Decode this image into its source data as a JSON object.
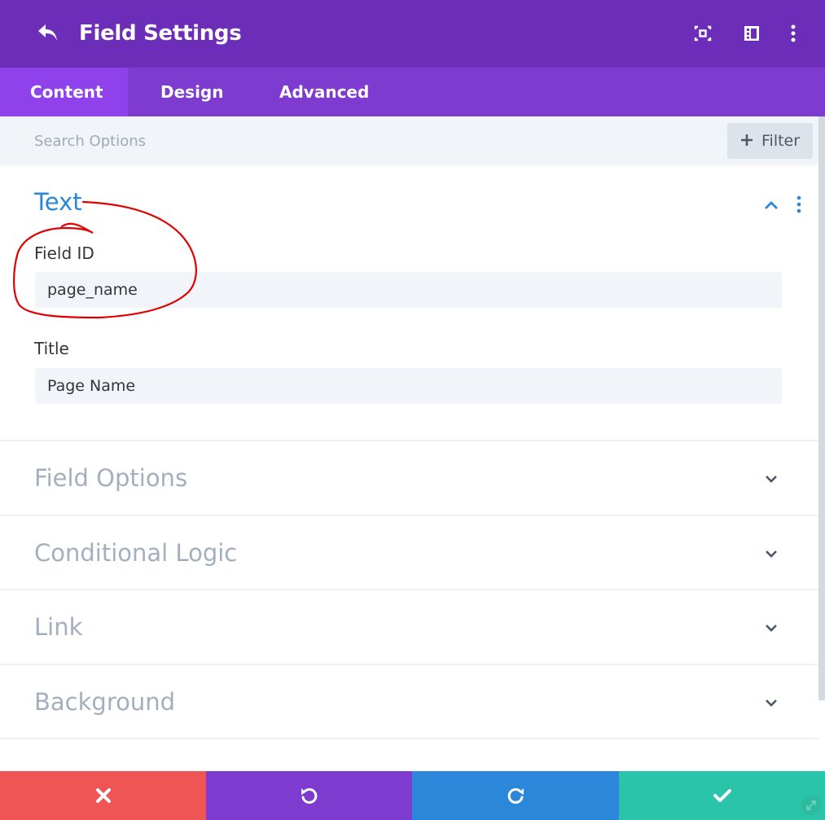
{
  "header": {
    "title": "Field Settings",
    "icons": [
      "back-icon",
      "focus-icon",
      "sidebar-layout-icon",
      "more-vertical-icon"
    ]
  },
  "tabs": [
    {
      "label": "Content",
      "active": true
    },
    {
      "label": "Design",
      "active": false
    },
    {
      "label": "Advanced",
      "active": false
    }
  ],
  "search": {
    "placeholder": "Search Options",
    "value": "",
    "filter_label": "Filter"
  },
  "sections": {
    "text": {
      "title": "Text",
      "expanded": true,
      "fields": [
        {
          "label": "Field ID",
          "value": "page_name"
        },
        {
          "label": "Title",
          "value": "Page Name"
        }
      ]
    },
    "collapsed": [
      {
        "title": "Field Options"
      },
      {
        "title": "Conditional Logic"
      },
      {
        "title": "Link"
      },
      {
        "title": "Background"
      }
    ]
  },
  "footer": {
    "buttons": [
      {
        "name": "discard",
        "icon": "close-icon",
        "color": "#ef5555"
      },
      {
        "name": "undo",
        "icon": "undo-icon",
        "color": "#7d3bcf"
      },
      {
        "name": "redo",
        "icon": "redo-icon",
        "color": "#2b87da"
      },
      {
        "name": "save",
        "icon": "check-icon",
        "color": "#29c4a9"
      }
    ]
  },
  "colors": {
    "header_bg": "#6c2eb9",
    "tabs_bg": "#7e3bd0",
    "active_tab_bg": "#8f42ec",
    "accent_blue": "#2b87da",
    "annotation_red": "#e00000"
  }
}
